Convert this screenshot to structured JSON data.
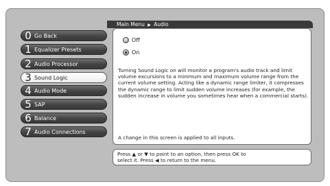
{
  "header": {
    "parent": "Main Menu",
    "separator": "▶",
    "current": "Audio"
  },
  "menu": [
    {
      "num": "0",
      "label": "Go Back"
    },
    {
      "num": "1",
      "label": "Equalizer Presets"
    },
    {
      "num": "2",
      "label": "Audio Processor"
    },
    {
      "num": "3",
      "label": "Sound Logic",
      "selected": true
    },
    {
      "num": "4",
      "label": "Audio Mode"
    },
    {
      "num": "5",
      "label": "SAP"
    },
    {
      "num": "6",
      "label": "Balance"
    },
    {
      "num": "7",
      "label": "Audio Connections"
    }
  ],
  "options": [
    {
      "label": "Off",
      "checked": false
    },
    {
      "label": "On",
      "checked": true
    }
  ],
  "description": "Turning Sound Logic on will monitor a program's audio track and limit volume excursions to a minimum and maximum volume range from the current volume setting. Acting like a dynamic range limiter, it compresses the dynamic range to limit sudden volume increases (for example, the sudden increase in volume you sometimes hear when a commercial starts).",
  "note": "A change in this screen is applied to all inputs.",
  "help": {
    "line1": "Press ▲ or ▼ to point to an option, then press OK to",
    "line2": "select it. Press ◀ to return to the menu."
  },
  "colors": {
    "background": "#bdbdbd",
    "menu_button": "#444444",
    "selected_button": "#ffffff",
    "header_bar": "#3a3a3a"
  }
}
